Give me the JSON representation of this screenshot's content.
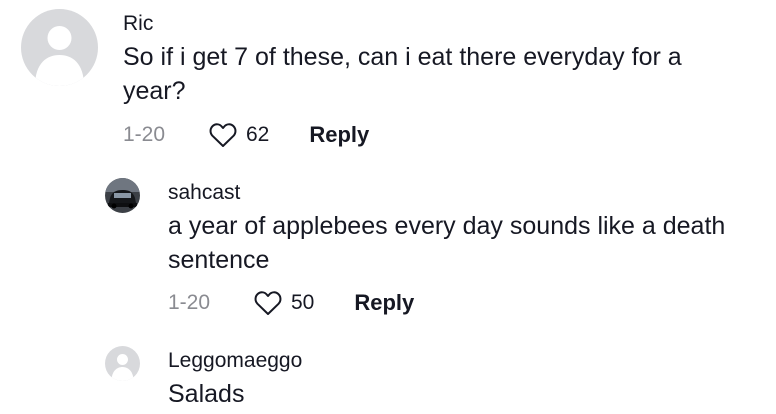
{
  "comments": [
    {
      "username": "Ric",
      "text": "So if i get 7 of these, can i eat there everyday for a year?",
      "date": "1-20",
      "likes": "62",
      "reply_label": "Reply",
      "avatar_icon": "default-avatar-icon"
    },
    {
      "username": "sahcast",
      "text": "a year of applebees every day sounds like a death sentence",
      "date": "1-20",
      "likes": "50",
      "reply_label": "Reply",
      "avatar_icon": "car-photo-avatar"
    },
    {
      "username": "Leggomaeggo",
      "text": "Salads",
      "avatar_icon": "default-avatar-icon"
    }
  ],
  "colors": {
    "text_primary": "#161823",
    "text_secondary": "#8a8b91",
    "avatar_placeholder": "#d8d9dc"
  }
}
